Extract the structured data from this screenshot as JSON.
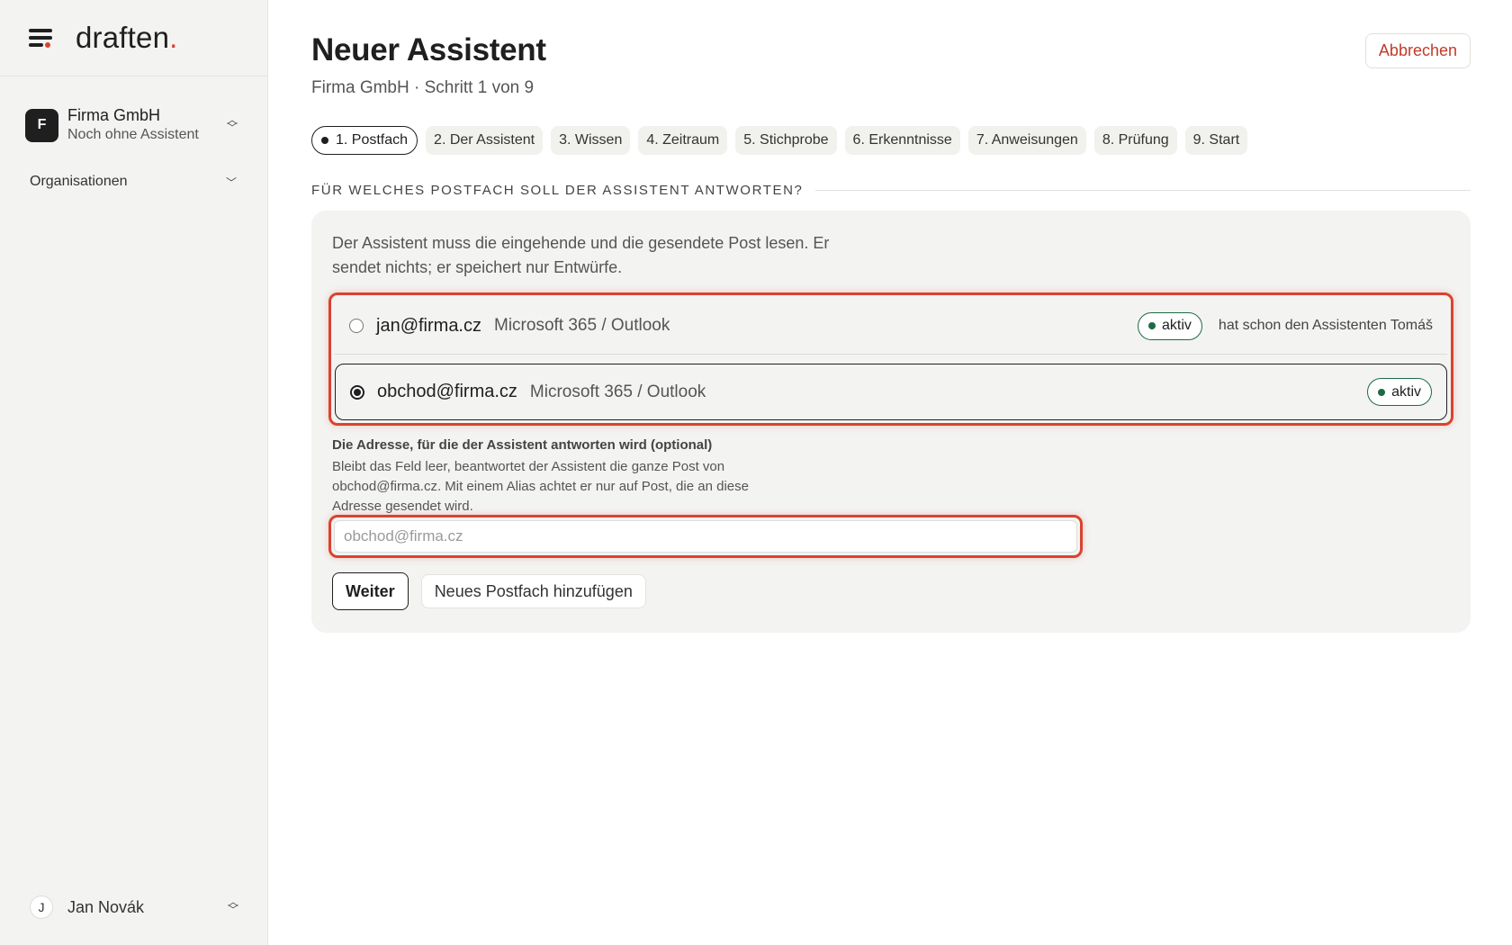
{
  "sidebar": {
    "brand": {
      "name": "draften",
      "dot": "."
    },
    "org": {
      "initial": "F",
      "name": "Firma GmbH",
      "subtitle": "Noch ohne Assistent"
    },
    "organizations_label": "Organisationen",
    "user": {
      "initial": "J",
      "name": "Jan Novák"
    }
  },
  "header": {
    "title": "Neuer Assistent",
    "subtitle": "Firma GmbH · Schritt 1 von 9",
    "cancel_label": "Abbrechen"
  },
  "steps": [
    {
      "label": "1. Postfach",
      "active": true
    },
    {
      "label": "2. Der Assistent"
    },
    {
      "label": "3. Wissen"
    },
    {
      "label": "4. Zeitraum"
    },
    {
      "label": "5. Stichprobe"
    },
    {
      "label": "6. Erkenntnisse"
    },
    {
      "label": "7. Anweisungen"
    },
    {
      "label": "8. Prüfung"
    },
    {
      "label": "9. Start"
    }
  ],
  "section": {
    "heading": "FÜR WELCHES POSTFACH SOLL DER ASSISTENT ANTWORTEN?",
    "intro": "Der Assistent muss die eingehende und die gesendete Post lesen. Er sendet nichts; er speichert nur Entwürfe."
  },
  "mailboxes": [
    {
      "address": "jan@firma.cz",
      "provider": "Microsoft 365 / Outlook",
      "status": "aktiv",
      "note": "hat schon den Assistenten Tomáš",
      "selected": false
    },
    {
      "address": "obchod@firma.cz",
      "provider": "Microsoft 365 / Outlook",
      "status": "aktiv",
      "note": "",
      "selected": true
    }
  ],
  "alias": {
    "label": "Die Adresse, für die der Assistent antworten wird (optional)",
    "help": "Bleibt das Feld leer, beantwortet der Assistent die ganze Post von obchod@firma.cz. Mit einem Alias achtet er nur auf Post, die an diese Adresse gesendet wird.",
    "value": "",
    "placeholder": "obchod@firma.cz"
  },
  "actions": {
    "next_label": "Weiter",
    "add_mailbox_label": "Neues Postfach hinzufügen"
  },
  "colors": {
    "accent": "#d9432f",
    "active_green": "#1d6b45",
    "text": "#1f1f1f",
    "sidebar_bg": "#f3f3f1"
  }
}
